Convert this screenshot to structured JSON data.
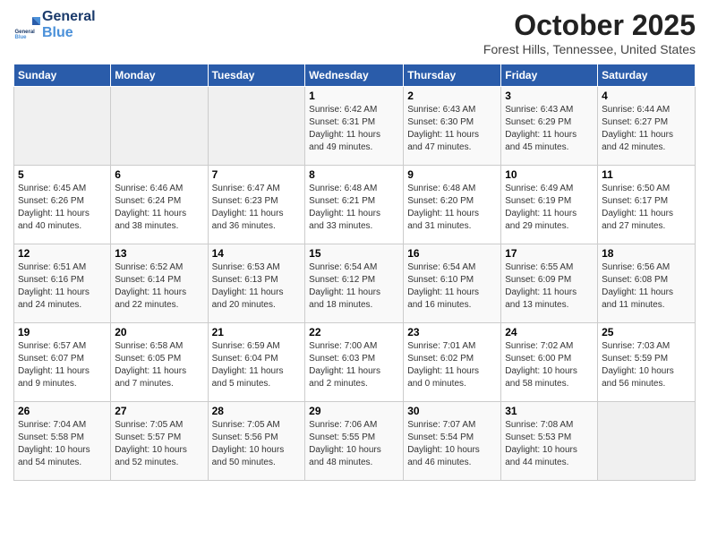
{
  "header": {
    "logo_line1": "General",
    "logo_line2": "Blue",
    "title": "October 2025",
    "subtitle": "Forest Hills, Tennessee, United States"
  },
  "weekdays": [
    "Sunday",
    "Monday",
    "Tuesday",
    "Wednesday",
    "Thursday",
    "Friday",
    "Saturday"
  ],
  "weeks": [
    [
      {
        "day": "",
        "info": ""
      },
      {
        "day": "",
        "info": ""
      },
      {
        "day": "",
        "info": ""
      },
      {
        "day": "1",
        "info": "Sunrise: 6:42 AM\nSunset: 6:31 PM\nDaylight: 11 hours\nand 49 minutes."
      },
      {
        "day": "2",
        "info": "Sunrise: 6:43 AM\nSunset: 6:30 PM\nDaylight: 11 hours\nand 47 minutes."
      },
      {
        "day": "3",
        "info": "Sunrise: 6:43 AM\nSunset: 6:29 PM\nDaylight: 11 hours\nand 45 minutes."
      },
      {
        "day": "4",
        "info": "Sunrise: 6:44 AM\nSunset: 6:27 PM\nDaylight: 11 hours\nand 42 minutes."
      }
    ],
    [
      {
        "day": "5",
        "info": "Sunrise: 6:45 AM\nSunset: 6:26 PM\nDaylight: 11 hours\nand 40 minutes."
      },
      {
        "day": "6",
        "info": "Sunrise: 6:46 AM\nSunset: 6:24 PM\nDaylight: 11 hours\nand 38 minutes."
      },
      {
        "day": "7",
        "info": "Sunrise: 6:47 AM\nSunset: 6:23 PM\nDaylight: 11 hours\nand 36 minutes."
      },
      {
        "day": "8",
        "info": "Sunrise: 6:48 AM\nSunset: 6:21 PM\nDaylight: 11 hours\nand 33 minutes."
      },
      {
        "day": "9",
        "info": "Sunrise: 6:48 AM\nSunset: 6:20 PM\nDaylight: 11 hours\nand 31 minutes."
      },
      {
        "day": "10",
        "info": "Sunrise: 6:49 AM\nSunset: 6:19 PM\nDaylight: 11 hours\nand 29 minutes."
      },
      {
        "day": "11",
        "info": "Sunrise: 6:50 AM\nSunset: 6:17 PM\nDaylight: 11 hours\nand 27 minutes."
      }
    ],
    [
      {
        "day": "12",
        "info": "Sunrise: 6:51 AM\nSunset: 6:16 PM\nDaylight: 11 hours\nand 24 minutes."
      },
      {
        "day": "13",
        "info": "Sunrise: 6:52 AM\nSunset: 6:14 PM\nDaylight: 11 hours\nand 22 minutes."
      },
      {
        "day": "14",
        "info": "Sunrise: 6:53 AM\nSunset: 6:13 PM\nDaylight: 11 hours\nand 20 minutes."
      },
      {
        "day": "15",
        "info": "Sunrise: 6:54 AM\nSunset: 6:12 PM\nDaylight: 11 hours\nand 18 minutes."
      },
      {
        "day": "16",
        "info": "Sunrise: 6:54 AM\nSunset: 6:10 PM\nDaylight: 11 hours\nand 16 minutes."
      },
      {
        "day": "17",
        "info": "Sunrise: 6:55 AM\nSunset: 6:09 PM\nDaylight: 11 hours\nand 13 minutes."
      },
      {
        "day": "18",
        "info": "Sunrise: 6:56 AM\nSunset: 6:08 PM\nDaylight: 11 hours\nand 11 minutes."
      }
    ],
    [
      {
        "day": "19",
        "info": "Sunrise: 6:57 AM\nSunset: 6:07 PM\nDaylight: 11 hours\nand 9 minutes."
      },
      {
        "day": "20",
        "info": "Sunrise: 6:58 AM\nSunset: 6:05 PM\nDaylight: 11 hours\nand 7 minutes."
      },
      {
        "day": "21",
        "info": "Sunrise: 6:59 AM\nSunset: 6:04 PM\nDaylight: 11 hours\nand 5 minutes."
      },
      {
        "day": "22",
        "info": "Sunrise: 7:00 AM\nSunset: 6:03 PM\nDaylight: 11 hours\nand 2 minutes."
      },
      {
        "day": "23",
        "info": "Sunrise: 7:01 AM\nSunset: 6:02 PM\nDaylight: 11 hours\nand 0 minutes."
      },
      {
        "day": "24",
        "info": "Sunrise: 7:02 AM\nSunset: 6:00 PM\nDaylight: 10 hours\nand 58 minutes."
      },
      {
        "day": "25",
        "info": "Sunrise: 7:03 AM\nSunset: 5:59 PM\nDaylight: 10 hours\nand 56 minutes."
      }
    ],
    [
      {
        "day": "26",
        "info": "Sunrise: 7:04 AM\nSunset: 5:58 PM\nDaylight: 10 hours\nand 54 minutes."
      },
      {
        "day": "27",
        "info": "Sunrise: 7:05 AM\nSunset: 5:57 PM\nDaylight: 10 hours\nand 52 minutes."
      },
      {
        "day": "28",
        "info": "Sunrise: 7:05 AM\nSunset: 5:56 PM\nDaylight: 10 hours\nand 50 minutes."
      },
      {
        "day": "29",
        "info": "Sunrise: 7:06 AM\nSunset: 5:55 PM\nDaylight: 10 hours\nand 48 minutes."
      },
      {
        "day": "30",
        "info": "Sunrise: 7:07 AM\nSunset: 5:54 PM\nDaylight: 10 hours\nand 46 minutes."
      },
      {
        "day": "31",
        "info": "Sunrise: 7:08 AM\nSunset: 5:53 PM\nDaylight: 10 hours\nand 44 minutes."
      },
      {
        "day": "",
        "info": ""
      }
    ]
  ]
}
